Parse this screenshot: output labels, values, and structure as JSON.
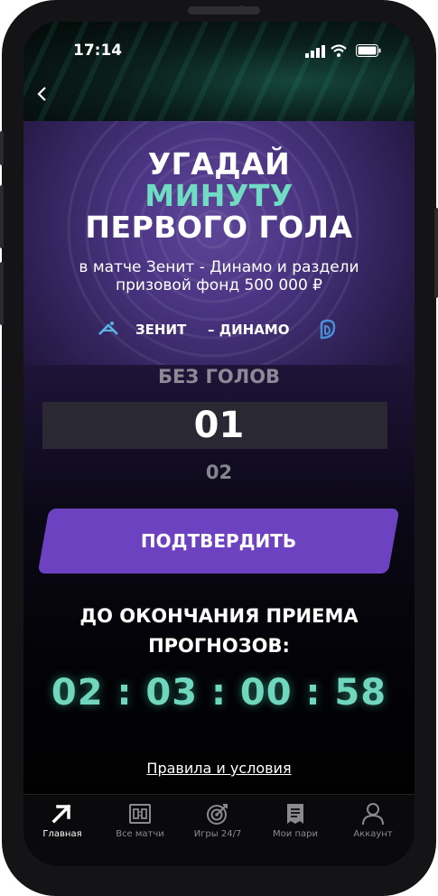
{
  "status_bar": {
    "time": "17:14"
  },
  "promo": {
    "title_line1": "УГАДАЙ",
    "title_line2": "МИНУТУ",
    "title_line3": "ПЕРВОГО ГОЛА",
    "subtitle": "в матче Зенит - Динамо и раздели призовой фонд 500 000 ₽",
    "accent_color": "#6fdcc3"
  },
  "match": {
    "team_home": "ЗЕНИТ",
    "team_away": "– ДИНАМО"
  },
  "minute_picker": {
    "previous_option": "БЕЗ ГОЛОВ",
    "selected_option": "01",
    "next_option": "02"
  },
  "confirm_button": {
    "label": "ПОДТВЕРДИТЬ",
    "color": "#6c42c0"
  },
  "deadline": {
    "label": "ДО ОКОНЧАНИЯ ПРИЕМА ПРОГНОЗОВ:",
    "countdown": "02 : 03 : 00 : 58",
    "countdown_color": "#70d6bd"
  },
  "rules_link": "Правила и условия",
  "tab_bar": {
    "items": [
      {
        "label": "Главная",
        "icon": "arrow-up-right-icon",
        "active": true
      },
      {
        "label": "Все матчи",
        "icon": "scoreboard-icon",
        "active": false
      },
      {
        "label": "Игры 24/7",
        "icon": "target-icon",
        "active": false
      },
      {
        "label": "Мои пари",
        "icon": "receipt-icon",
        "active": false
      },
      {
        "label": "Аккаунт",
        "icon": "user-icon",
        "active": false
      }
    ]
  }
}
